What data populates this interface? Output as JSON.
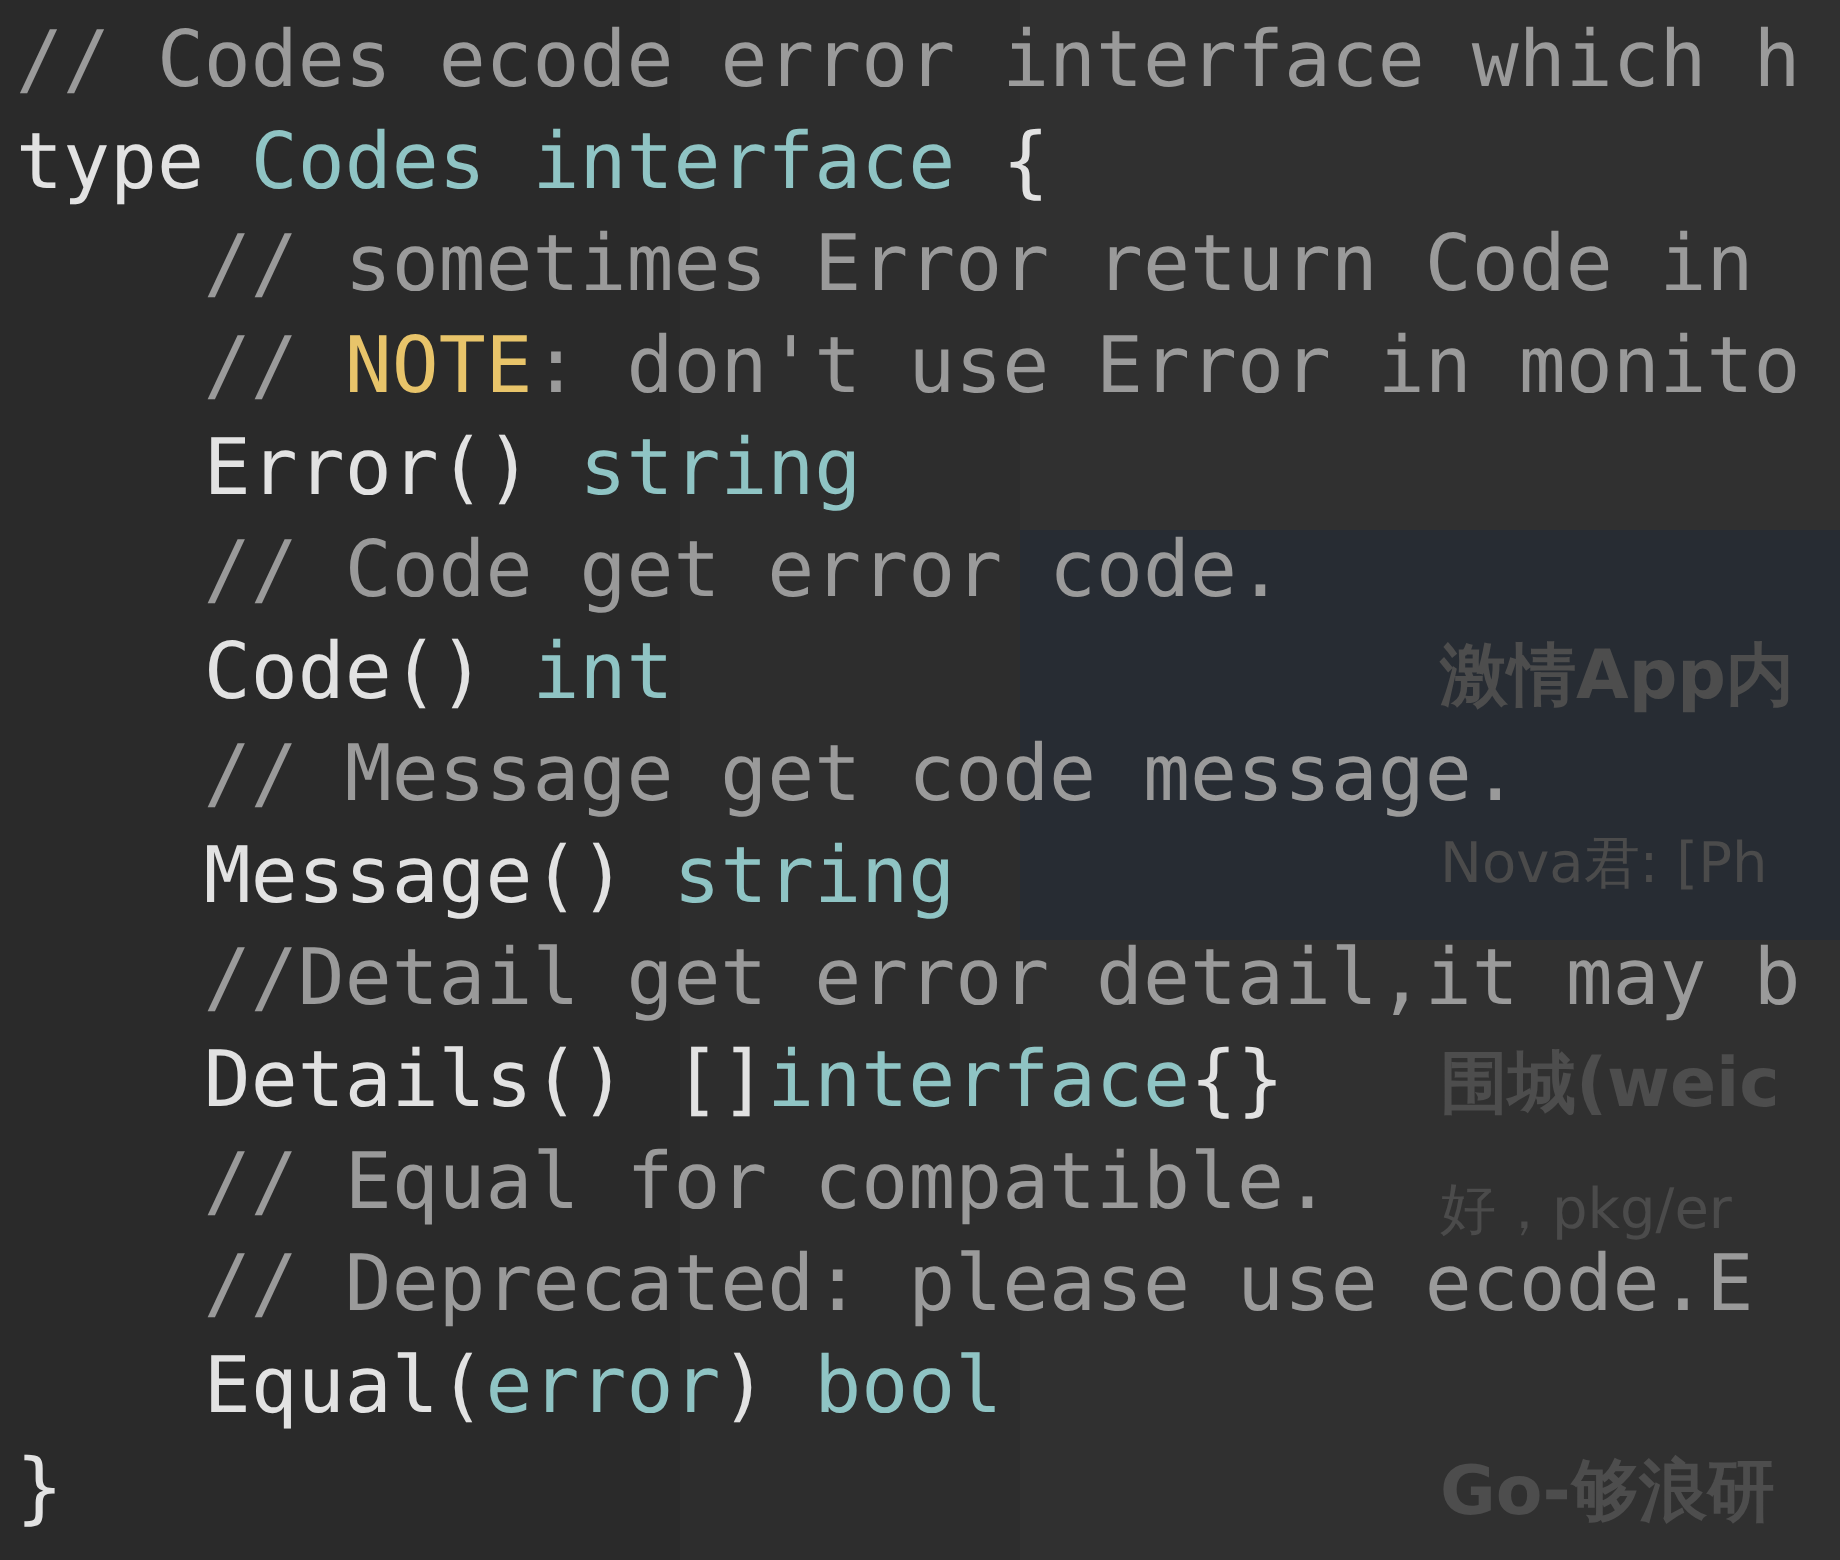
{
  "background_items": [
    {
      "title": "激情App内",
      "subtitle": "Nova君: [Ph"
    },
    {
      "title": "围城(weic",
      "subtitle": "好，pkg/er"
    },
    {
      "title": "Go-够浪研"
    }
  ],
  "code": {
    "lines": [
      {
        "tokens": [
          {
            "kind": "comment",
            "text": "// Codes ecode error interface which h"
          }
        ]
      },
      {
        "tokens": [
          {
            "kind": "plain",
            "text": "type "
          },
          {
            "kind": "type",
            "text": "Codes interface"
          },
          {
            "kind": "plain",
            "text": " {"
          }
        ],
        "children": [
          {
            "tokens": [
              {
                "kind": "comment",
                "text": "// sometimes Error return Code in"
              }
            ]
          },
          {
            "tokens": [
              {
                "kind": "comment",
                "text": "// "
              },
              {
                "kind": "note",
                "text": "NOTE"
              },
              {
                "kind": "comment",
                "text": ": don't use Error in monito"
              }
            ]
          },
          {
            "tokens": [
              {
                "kind": "plain",
                "text": "Error() "
              },
              {
                "kind": "type",
                "text": "string"
              }
            ]
          },
          {
            "tokens": [
              {
                "kind": "comment",
                "text": "// Code get error code."
              }
            ]
          },
          {
            "tokens": [
              {
                "kind": "plain",
                "text": "Code() "
              },
              {
                "kind": "type",
                "text": "int"
              }
            ]
          },
          {
            "tokens": [
              {
                "kind": "comment",
                "text": "// Message get code message."
              }
            ]
          },
          {
            "tokens": [
              {
                "kind": "plain",
                "text": "Message() "
              },
              {
                "kind": "type",
                "text": "string"
              }
            ]
          },
          {
            "tokens": [
              {
                "kind": "comment",
                "text": "//Detail get error detail,it may b"
              }
            ]
          },
          {
            "tokens": [
              {
                "kind": "plain",
                "text": "Details() []"
              },
              {
                "kind": "type",
                "text": "interface"
              },
              {
                "kind": "plain",
                "text": "{}"
              }
            ]
          },
          {
            "tokens": [
              {
                "kind": "comment",
                "text": "// Equal for compatible."
              }
            ]
          },
          {
            "tokens": [
              {
                "kind": "comment",
                "text": "// Deprecated: please use ecode.E"
              }
            ]
          },
          {
            "tokens": [
              {
                "kind": "plain",
                "text": "Equal("
              },
              {
                "kind": "type",
                "text": "error"
              },
              {
                "kind": "plain",
                "text": ") "
              },
              {
                "kind": "type",
                "text": "bool"
              }
            ]
          }
        ]
      },
      {
        "tokens": [
          {
            "kind": "plain",
            "text": "}"
          }
        ]
      }
    ]
  }
}
